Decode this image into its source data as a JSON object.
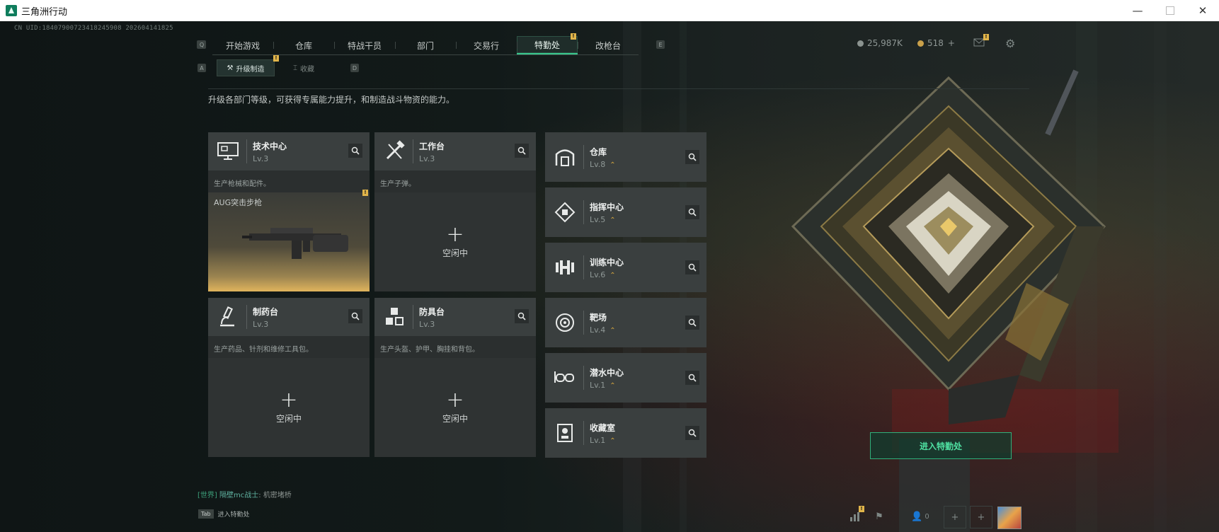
{
  "window": {
    "title": "三角洲行动",
    "minimize": "—",
    "close": "✕"
  },
  "uid": "CN UID:18407900723418245908 202604141825",
  "nav": {
    "key_left": "Q",
    "key_right": "E",
    "tabs": [
      "开始游戏",
      "仓库",
      "特战干员",
      "部门",
      "交易行",
      "特勤处",
      "改枪台"
    ],
    "active": "特勤处",
    "badge": "!"
  },
  "currency": {
    "coins": "25,987K",
    "tickets": "518",
    "tickets_add": "+"
  },
  "subnav": {
    "key_left": "A",
    "key_right": "D",
    "tabs": [
      "升级制造",
      "收藏"
    ],
    "active": "升级制造",
    "badge": "!"
  },
  "description": "升级各部门等级，可获得专属能力提升，和制造战斗物资的能力。",
  "cards": [
    {
      "name": "技术中心",
      "level": "Lv.3",
      "desc": "生产枪械和配件。",
      "crafting": "AUG突击步枪",
      "icon": "monitor-icon",
      "badge": "!"
    },
    {
      "name": "工作台",
      "level": "Lv.3",
      "desc": "生产子弹。",
      "idle": "空闲中",
      "plus": "+",
      "icon": "tools-icon"
    },
    {
      "name": "制药台",
      "level": "Lv.3",
      "desc": "生产药品、针剂和维修工具包。",
      "idle": "空闲中",
      "plus": "+",
      "icon": "microscope-icon"
    },
    {
      "name": "防具台",
      "level": "Lv.3",
      "desc": "生产头盔、护甲、胸挂和背包。",
      "idle": "空闲中",
      "plus": "+",
      "icon": "cubes-icon"
    }
  ],
  "side": [
    {
      "name": "仓库",
      "level": "Lv.8",
      "icon": "warehouse-icon"
    },
    {
      "name": "指挥中心",
      "level": "Lv.5",
      "icon": "command-icon"
    },
    {
      "name": "训练中心",
      "level": "Lv.6",
      "icon": "dumbbell-icon"
    },
    {
      "name": "靶场",
      "level": "Lv.4",
      "icon": "target-icon"
    },
    {
      "name": "潜水中心",
      "level": "Lv.1",
      "icon": "diving-mask-icon"
    },
    {
      "name": "收藏室",
      "level": "Lv.1",
      "icon": "collection-icon"
    }
  ],
  "lvup_glyph": "⌃",
  "enter_button": "进入特勤处",
  "chat": {
    "channel": "[世界]",
    "nick": "隔壁mc战士",
    "message": "机密堵桥"
  },
  "tabhint": {
    "key": "Tab",
    "label": "进入特勤处"
  },
  "bottom": {
    "friends": "0",
    "plus": "+",
    "badge": "!"
  },
  "colors": {
    "accent": "#39c88e",
    "gold": "#d6a73e",
    "card": "#3a3f3f"
  }
}
